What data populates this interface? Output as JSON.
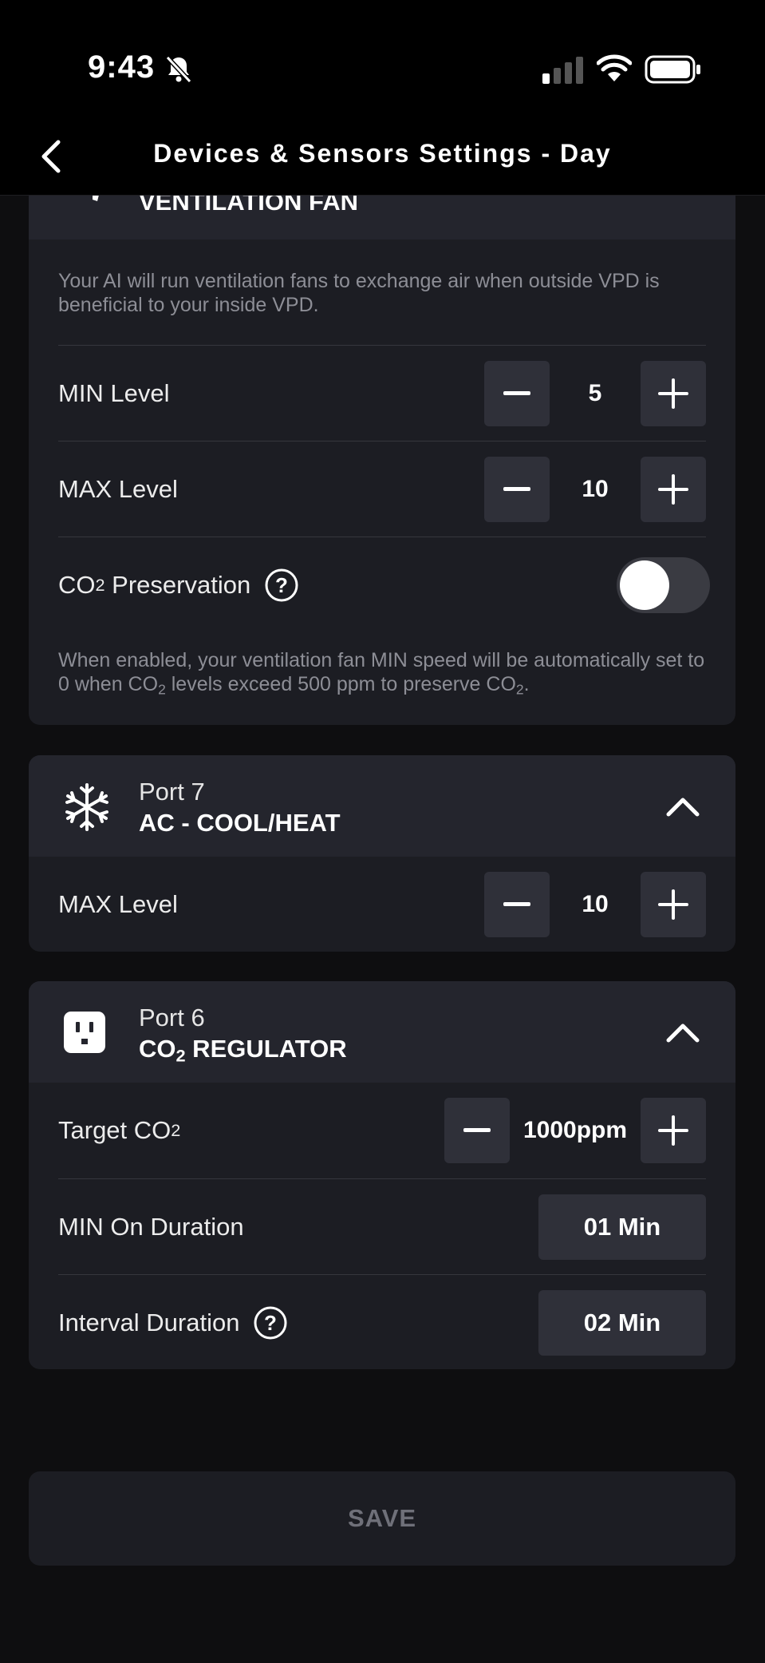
{
  "status_bar": {
    "time": "9:43",
    "icons": [
      "bell-slash-icon",
      "cellular-signal-icon",
      "wifi-icon",
      "battery-icon"
    ]
  },
  "nav": {
    "back_icon": "chevron-left-icon",
    "title": "Devices & Sensors Settings - Day"
  },
  "ventilation_card": {
    "name": "VENTILATION FAN",
    "description": "Your AI will run ventilation fans to exchange air when outside VPD is beneficial to your inside VPD.",
    "min_level": {
      "label": "MIN Level",
      "value": "5"
    },
    "max_level": {
      "label": "MAX Level",
      "value": "10"
    },
    "co2_preservation": {
      "label_prefix": "CO",
      "label_sub": "2",
      "label_suffix": " Preservation",
      "enabled": false
    },
    "co2_note": {
      "part1": "When enabled, your ventilation fan MIN speed will be automatically set to 0 when CO",
      "sub1": "2",
      "part2": " levels exceed 500 ppm to preserve CO",
      "sub2": "2",
      "part3": "."
    }
  },
  "ac_card": {
    "port": "Port 7",
    "name": "AC - COOL/HEAT",
    "icon": "snowflake-icon",
    "max_level": {
      "label": "MAX Level",
      "value": "10"
    }
  },
  "co2_card": {
    "port": "Port 6",
    "name_prefix": "CO",
    "name_sub": "2",
    "name_suffix": " REGULATOR",
    "icon": "outlet-icon",
    "target": {
      "label_prefix": "Target CO",
      "label_sub": "2",
      "value": "1000ppm"
    },
    "min_on": {
      "label": "MIN On Duration",
      "value": "01 Min"
    },
    "interval": {
      "label": "Interval Duration",
      "value": "02 Min"
    }
  },
  "save_label": "SAVE",
  "colors": {
    "background": "#0e0e10",
    "card": "#1c1d23",
    "card_header": "#24252d",
    "button": "#2f3039",
    "muted_text": "#8d8e96",
    "disabled_text": "#6f7079"
  }
}
